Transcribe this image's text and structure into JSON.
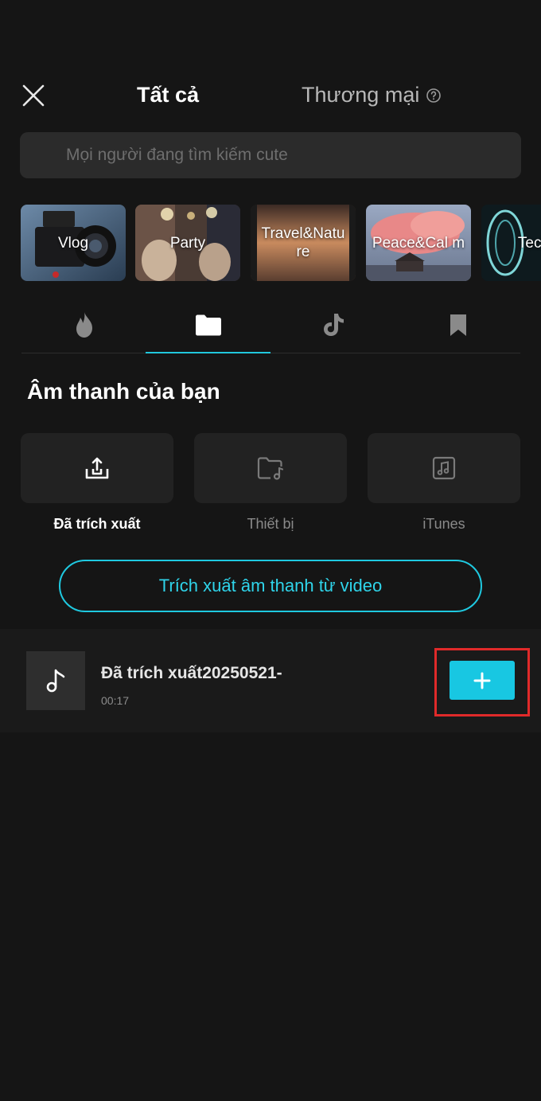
{
  "header": {
    "tab_all": "Tất cả",
    "tab_commercial": "Thương mại"
  },
  "search": {
    "placeholder": "Mọi người đang tìm kiếm cute"
  },
  "categories": [
    {
      "label": "Vlog"
    },
    {
      "label": "Party"
    },
    {
      "label": "Travel&Natu re"
    },
    {
      "label": "Peace&Cal m"
    },
    {
      "label": "Tech"
    }
  ],
  "icon_tabs": [
    {
      "icon": "fire-icon"
    },
    {
      "icon": "folder-icon",
      "active": true
    },
    {
      "icon": "tiktok-icon"
    },
    {
      "icon": "bookmark-icon"
    }
  ],
  "section": {
    "title": "Âm thanh của bạn"
  },
  "sources": [
    {
      "label": "Đã trích xuất",
      "icon": "extract-icon"
    },
    {
      "label": "Thiết bị",
      "icon": "folder-music-icon"
    },
    {
      "label": "iTunes",
      "icon": "music-file-icon"
    }
  ],
  "extract_button": {
    "label": "Trích xuất âm thanh từ video"
  },
  "tracks": [
    {
      "name": "Đã trích xuất20250521-",
      "duration": "00:17"
    }
  ],
  "colors": {
    "accent": "#1fc9e0",
    "background": "#151515",
    "highlight": "#e02a2a"
  }
}
